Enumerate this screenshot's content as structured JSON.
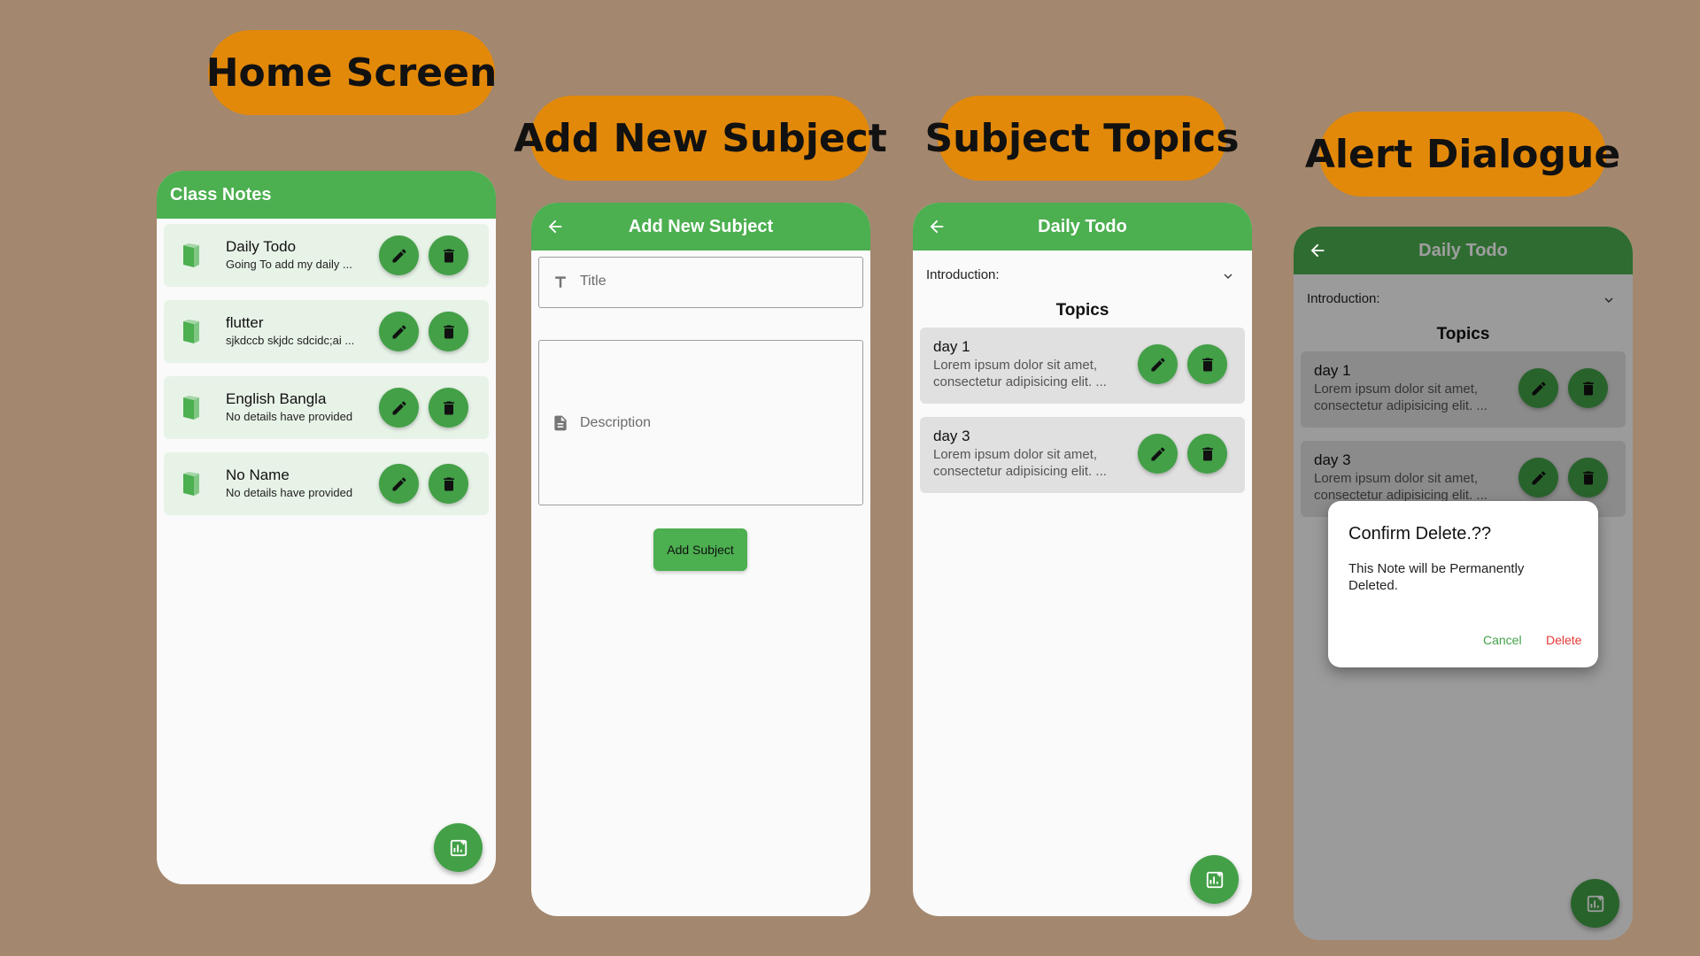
{
  "labels": {
    "home": "Home Screen",
    "add": "Add New Subject",
    "topics": "Subject Topics",
    "alert": "Alert Dialogue"
  },
  "home": {
    "appbar_title": "Class Notes",
    "notes": [
      {
        "title": "Daily Todo",
        "subtitle": "Going To add my daily ..."
      },
      {
        "title": "flutter",
        "subtitle": "sjkdccb skjdc sdcidc;ai ..."
      },
      {
        "title": "English Bangla",
        "subtitle": "No details have provided"
      },
      {
        "title": "No Name",
        "subtitle": "No details have provided"
      }
    ]
  },
  "add_subject": {
    "appbar_title": "Add New Subject",
    "title_placeholder": "Title",
    "description_placeholder": "Description",
    "button_label": "Add Subject"
  },
  "topics_screen": {
    "appbar_title": "Daily Todo",
    "intro_label": "Introduction:",
    "heading": "Topics",
    "topics": [
      {
        "title": "day 1",
        "body": "Lorem ipsum dolor sit amet, consectetur adipisicing elit. ..."
      },
      {
        "title": "day 3",
        "body": "Lorem ipsum dolor sit amet, consectetur adipisicing elit. ..."
      }
    ]
  },
  "dialog": {
    "title": "Confirm Delete.??",
    "body": "This Note will be Permanently Deleted.",
    "cancel": "Cancel",
    "delete": "Delete"
  },
  "colors": {
    "background": "#a3876e",
    "label_pill": "#e3890a",
    "appbar_green": "#4caf50",
    "button_green": "#43a047",
    "delete_red": "#e53935"
  },
  "icons": [
    "back-arrow-icon",
    "book-icon",
    "edit-icon",
    "delete-icon",
    "add-note-icon",
    "title-icon",
    "description-icon",
    "chevron-down-icon"
  ]
}
